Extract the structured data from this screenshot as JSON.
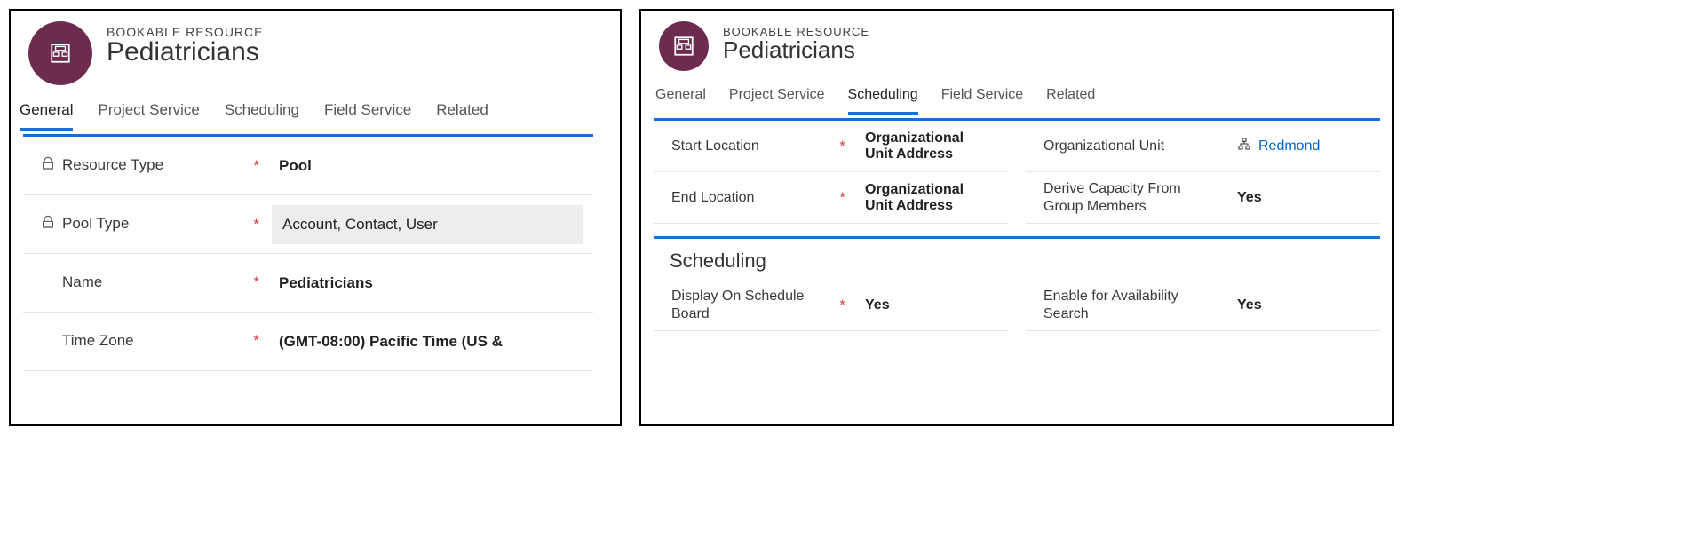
{
  "left": {
    "entityType": "BOOKABLE RESOURCE",
    "title": "Pediatricians",
    "tabs": [
      "General",
      "Project Service",
      "Scheduling",
      "Field Service",
      "Related"
    ],
    "activeTab": 0,
    "fields": {
      "resourceType": {
        "label": "Resource Type",
        "value": "Pool",
        "locked": true,
        "required": true
      },
      "poolType": {
        "label": "Pool Type",
        "value": "Account, Contact, User",
        "locked": true,
        "required": true
      },
      "name": {
        "label": "Name",
        "value": "Pediatricians",
        "locked": false,
        "required": true
      },
      "timeZone": {
        "label": "Time Zone",
        "value": "(GMT-08:00) Pacific Time (US &",
        "locked": false,
        "required": true
      }
    }
  },
  "right": {
    "entityType": "BOOKABLE RESOURCE",
    "title": "Pediatricians",
    "tabs": [
      "General",
      "Project Service",
      "Scheduling",
      "Field Service",
      "Related"
    ],
    "activeTab": 2,
    "section1": {
      "startLocation": {
        "label": "Start Location",
        "value": "Organizational Unit Address",
        "required": true
      },
      "endLocation": {
        "label": "End Location",
        "value": "Organizational Unit Address",
        "required": true
      },
      "orgUnit": {
        "label": "Organizational Unit",
        "value": "Redmond"
      },
      "deriveCapacity": {
        "label": "Derive Capacity From Group Members",
        "value": "Yes"
      }
    },
    "section2": {
      "title": "Scheduling",
      "displayBoard": {
        "label": "Display On Schedule Board",
        "value": "Yes",
        "required": true
      },
      "availSearch": {
        "label": "Enable for Availability Search",
        "value": "Yes"
      }
    }
  }
}
